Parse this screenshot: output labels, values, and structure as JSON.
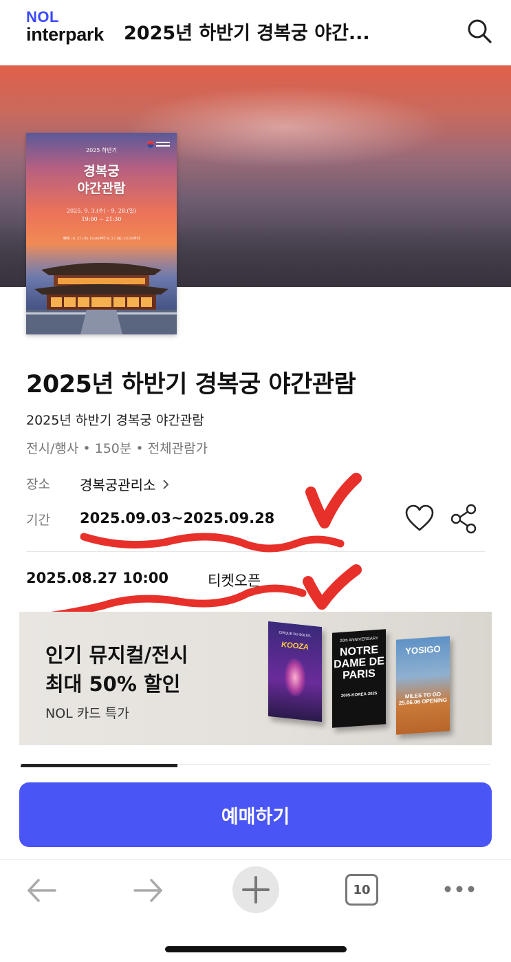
{
  "header": {
    "logo_top": "NOL",
    "logo_bottom": "interpark",
    "title": "2025년 하반기 경복궁 야간..."
  },
  "poster": {
    "year": "2025 하반기",
    "title_line1": "경복궁",
    "title_line2": "야간관람",
    "dates": "2025. 9. 3.(수) - 9. 28.(일)",
    "time": "19:00 ~ 21:30",
    "note": "예매 : 8. 27.(수) 10:00부터 9. 27.(토) 23:59까지"
  },
  "event": {
    "title": "2025년 하반기 경복궁 야간관람",
    "subtitle": "2025년 하반기 경복궁 야간관람",
    "meta": "전시/행사 • 150분 • 전체관람가",
    "venue_label": "장소",
    "venue": "경복궁관리소",
    "period_label": "기간",
    "period": "2025.09.03~2025.09.28",
    "ticket_open_date": "2025.08.27 10:00",
    "ticket_open_label": "티켓오픈"
  },
  "banner": {
    "line1": "인기 뮤지컬/전시",
    "line2": "최대 50% 할인",
    "sub": "NOL 카드 특가",
    "card1_top": "CIRQUE DU SOLEIL",
    "card1_title": "KOOZA",
    "card2_top": "20th ANNIVERSARY",
    "card2_title": "NOTRE DAME DE PARIS",
    "card2_sub": "2005-KOREA-2025",
    "card3_title": "YOSIGO",
    "card3_sub": "MILES TO GO 25.06.06 OPENING"
  },
  "actions": {
    "book": "예매하기"
  },
  "browser": {
    "tab_count": "10"
  },
  "colors": {
    "brand": "#3d4bff",
    "button": "#4a55f5",
    "annotation": "#e8302a"
  }
}
